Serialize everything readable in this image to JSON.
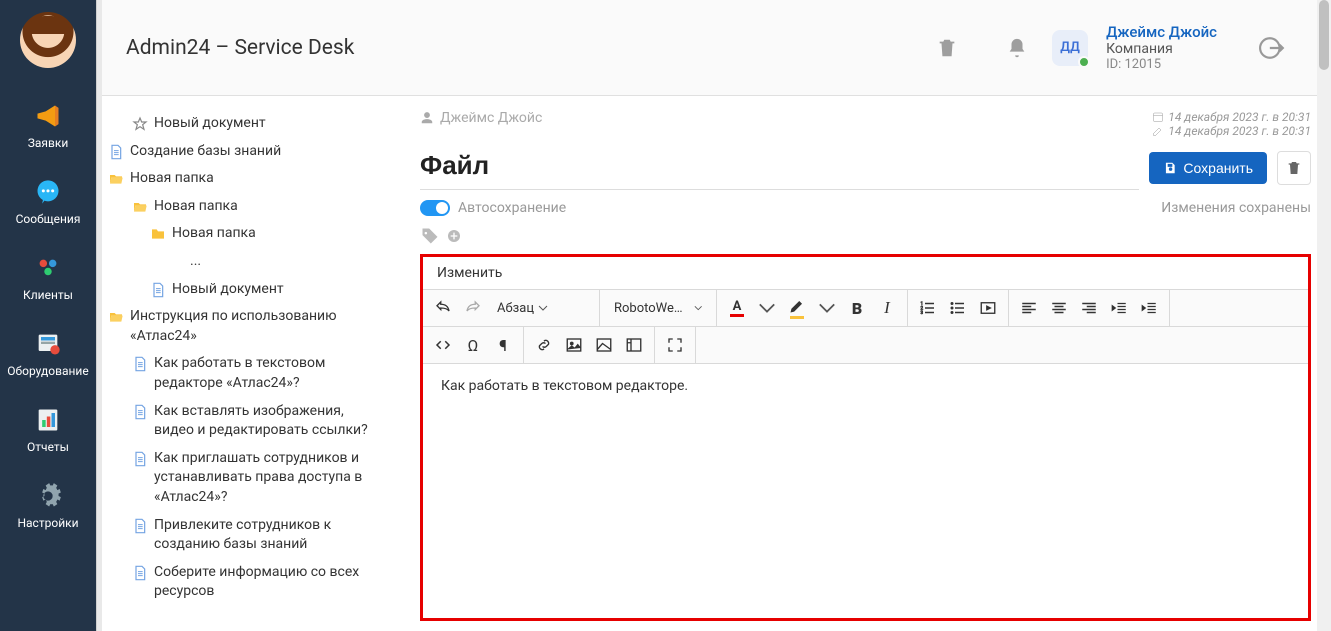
{
  "header": {
    "app_title": "Admin24 – Service Desk",
    "user_initials": "ДД",
    "user_name": "Джеймс Джойс",
    "company": "Компания",
    "id_label": "ID: 12015"
  },
  "sidebar": {
    "items": [
      {
        "label": "Заявки",
        "icon": "megaphone-icon"
      },
      {
        "label": "Сообщения",
        "icon": "chat-icon"
      },
      {
        "label": "Клиенты",
        "icon": "people-icon"
      },
      {
        "label": "Оборудование",
        "icon": "equipment-icon"
      },
      {
        "label": "Отчеты",
        "icon": "reports-icon"
      },
      {
        "label": "Настройки",
        "icon": "gear-icon"
      }
    ]
  },
  "tree": {
    "items": [
      {
        "label": "Новый документ",
        "icon": "star",
        "indent": 1
      },
      {
        "label": "Создание базы знаний",
        "icon": "doc",
        "indent": 0
      },
      {
        "label": "Новая папка",
        "icon": "folder-open",
        "indent": 0
      },
      {
        "label": "Новая папка",
        "icon": "folder-open",
        "indent": 1
      },
      {
        "label": "Новая папка",
        "icon": "folder",
        "indent": 2
      },
      {
        "label": "...",
        "icon": "none",
        "indent": 3
      },
      {
        "label": "Новый документ",
        "icon": "doc",
        "indent": 2
      },
      {
        "label": "Инструкция по использованию «Атлас24»",
        "icon": "folder-open",
        "indent": 0
      },
      {
        "label": "Как работать в текстовом редакторе «Атлас24»?",
        "icon": "doc",
        "indent": 1
      },
      {
        "label": "Как вставлять изображения, видео и редактировать ссылки?",
        "icon": "doc",
        "indent": 1
      },
      {
        "label": "Как приглашать сотрудников и устанавливать права доступа в «Атлас24»?",
        "icon": "doc",
        "indent": 1
      },
      {
        "label": "Привлеките сотрудников к созданию базы знаний",
        "icon": "doc",
        "indent": 1
      },
      {
        "label": "Соберите информацию со всех ресурсов",
        "icon": "doc",
        "indent": 1
      }
    ]
  },
  "document": {
    "author": "Джеймс Джойс",
    "created": "14 декабря 2023 г. в 20:31",
    "modified": "14 декабря 2023 г. в 20:31",
    "title": "Файл",
    "save_label": "Сохранить",
    "autosave_label": "Автосохранение",
    "changes_saved": "Изменения сохранены",
    "menu_edit": "Изменить",
    "paragraph_label": "Абзац",
    "font_label": "RobotoWeb,H...",
    "body_text": "Как работать в текстовом редакторе."
  }
}
